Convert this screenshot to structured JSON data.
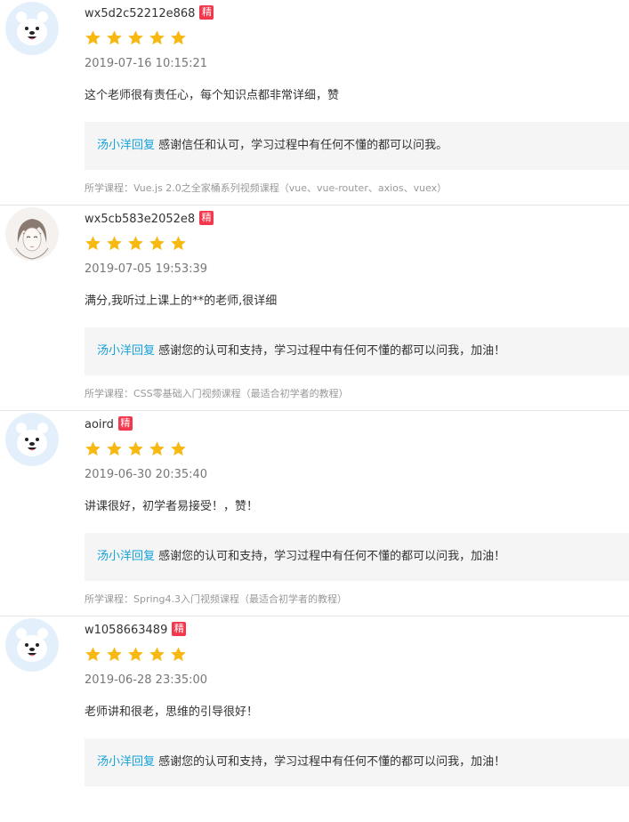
{
  "colors": {
    "accent": "#14a1d9",
    "badge": "#f3374d",
    "star": "#f6b811",
    "reply_bg": "#f5f5f5"
  },
  "reviews": [
    {
      "username": "wx5d2c52212e868",
      "badge": "精",
      "avatar": "polar-bear-avatar",
      "rating": 5,
      "time": "2019-07-16 10:15:21",
      "content": "这个老师很有责任心，每个知识点都非常详细，赞",
      "reply_author": "汤小洋回复",
      "reply_text": " 感谢信任和认可，学习过程中有任何不懂的都可以问我。",
      "course": "所学课程：Vue.js 2.0之全家桶系列视频课程（vue、vue-router、axios、vuex）"
    },
    {
      "username": "wx5cb583e2052e8",
      "badge": "精",
      "avatar": "sketch-portrait-avatar",
      "rating": 5,
      "time": "2019-07-05 19:53:39",
      "content": "满分,我听过上课上的**的老师,很详细",
      "reply_author": "汤小洋回复",
      "reply_text": " 感谢您的认可和支持，学习过程中有任何不懂的都可以问我，加油！",
      "course": "所学课程：CSS零基础入门视频课程（最适合初学者的教程）"
    },
    {
      "username": "aoird",
      "badge": "精",
      "avatar": "polar-bear-avatar",
      "rating": 5,
      "time": "2019-06-30 20:35:40",
      "content": "讲课很好，初学者易接受！，赞！",
      "reply_author": "汤小洋回复",
      "reply_text": " 感谢您的认可和支持，学习过程中有任何不懂的都可以问我，加油！",
      "course": "所学课程：Spring4.3入门视频课程（最适合初学者的教程）"
    },
    {
      "username": "w1058663489",
      "badge": "精",
      "avatar": "polar-bear-avatar",
      "rating": 5,
      "time": "2019-06-28 23:35:00",
      "content": "老师讲和很老，思维的引导很好！",
      "reply_author": "汤小洋回复",
      "reply_text": " 感谢您的认可和支持，学习过程中有任何不懂的都可以问我，加油！",
      "course": ""
    }
  ]
}
